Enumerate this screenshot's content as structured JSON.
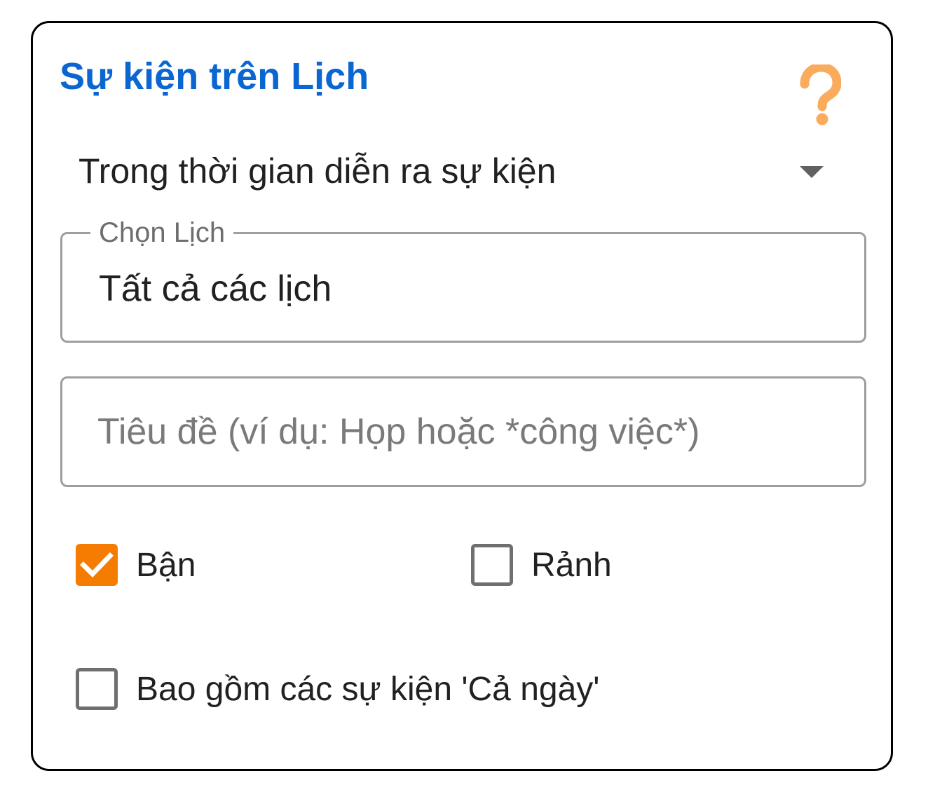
{
  "title": "Sự kiện trên Lịch",
  "help_icon": "question-mark-icon",
  "help_glyph": "?",
  "dropdown": {
    "selected": "Trong thời gian diễn ra sự kiện"
  },
  "calendar_field": {
    "label": "Chọn Lịch",
    "value": "Tất cả các lịch"
  },
  "title_field": {
    "placeholder": "Tiêu đề (ví dụ: Họp hoặc *công việc*)",
    "value": ""
  },
  "checkboxes": {
    "busy": {
      "label": "Bận",
      "checked": true
    },
    "free": {
      "label": "Rảnh",
      "checked": false
    },
    "all_day": {
      "label": "Bao gồm các sự kiện 'Cả ngày'",
      "checked": false
    }
  },
  "colors": {
    "title": "#0a66d0",
    "accent": "#f57c00",
    "help": "#fbab5c"
  }
}
